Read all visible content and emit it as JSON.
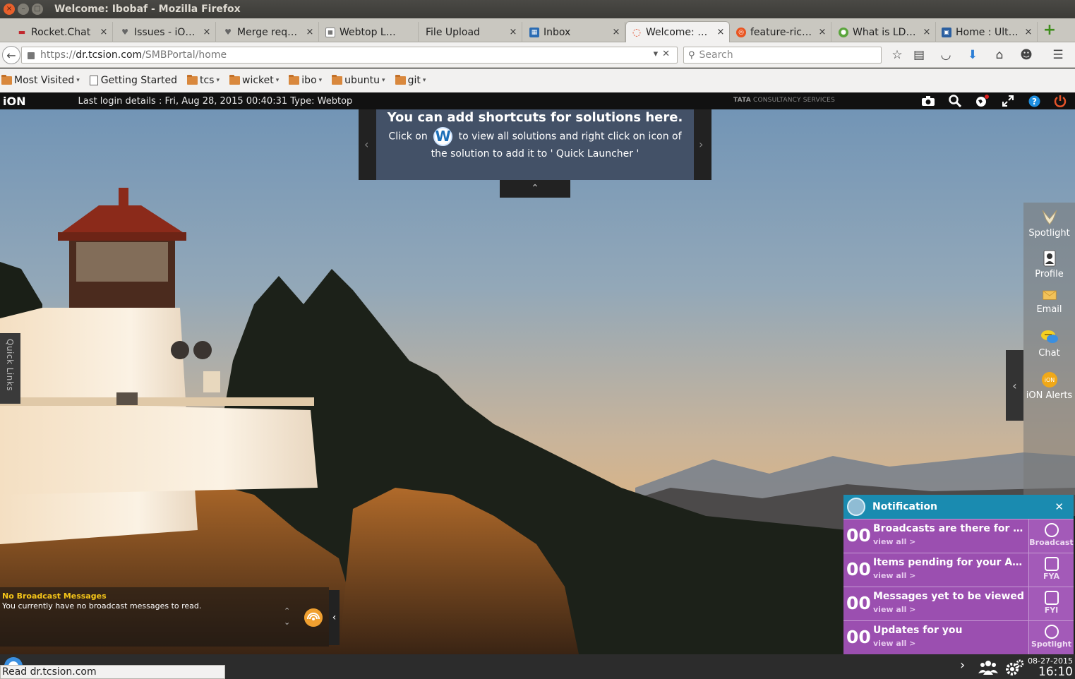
{
  "window": {
    "title": "Welcome: Ibobaf - Mozilla Firefox",
    "close_glyph": "×",
    "min_glyph": "–",
    "max_glyph": "□"
  },
  "tabs": [
    {
      "label": "Rocket.Chat",
      "active": false
    },
    {
      "label": "Issues - iO…",
      "active": false
    },
    {
      "label": "Merge req…",
      "active": false
    },
    {
      "label": "Webtop L…",
      "active": false
    },
    {
      "label": "File Upload",
      "active": false
    },
    {
      "label": "Inbox",
      "active": false
    },
    {
      "label": "Welcome: …",
      "active": true
    },
    {
      "label": "feature-ric…",
      "active": false
    },
    {
      "label": "What is LD…",
      "active": false
    },
    {
      "label": "Home : Ult…",
      "active": false
    }
  ],
  "tab_close_glyph": "×",
  "new_tab_glyph": "+",
  "nav": {
    "back_glyph": "←",
    "url_scheme": "https://",
    "url_host": "dr.tcsion.com",
    "url_path": "/SMBPortal/home",
    "url_tools": "▾✕",
    "search_placeholder": "Search",
    "search_glyph": "⚲",
    "icons": {
      "bookmark": "☆",
      "reading": "▤",
      "pocket": "◡",
      "download": "⬇",
      "home": "⌂",
      "chat": "☻",
      "menu": "☰"
    }
  },
  "bookmarks": [
    {
      "label": "Most Visited",
      "type": "folder",
      "dropdown": true
    },
    {
      "label": "Getting Started",
      "type": "page",
      "dropdown": false
    },
    {
      "label": "tcs",
      "type": "folder",
      "dropdown": true
    },
    {
      "label": "wicket",
      "type": "folder",
      "dropdown": true
    },
    {
      "label": "ibo",
      "type": "folder",
      "dropdown": true
    },
    {
      "label": "ubuntu",
      "type": "folder",
      "dropdown": true
    },
    {
      "label": "git",
      "type": "folder",
      "dropdown": true
    }
  ],
  "bookmark_caret": "▾",
  "ionbar": {
    "brand": "iON",
    "login_details": "Last login details : Fri, Aug 28, 2015 00:40:31 Type: Webtop",
    "vendor_bold": "TATA",
    "vendor_rest": " CONSULTANCY SERVICES"
  },
  "shortcut_panel": {
    "heading": "You can add shortcuts for solutions here.",
    "text_before": "Click on",
    "logo_letter": "W",
    "text_after": "to view all solutions and right click on icon of the solution to add it to ' Quick Launcher '",
    "prev_glyph": "‹",
    "next_glyph": "›",
    "toggle_glyph": "⌃"
  },
  "quick_links_label": "Quick Links",
  "right_sidebar": [
    {
      "label": "Spotlight",
      "icon": "spotlight-icon"
    },
    {
      "label": "Profile",
      "icon": "profile-icon"
    },
    {
      "label": "Email",
      "icon": "email-icon"
    },
    {
      "label": "Chat",
      "icon": "chat-icon"
    },
    {
      "label": "iON Alerts",
      "icon": "ion-alerts-icon"
    }
  ],
  "right_sidebar_collapse_glyph": "‹",
  "ion_alert_badge": "iON",
  "broadcast": {
    "title": "No Broadcast Messages",
    "message": "You currently have no broadcast messages to read.",
    "up_glyph": "⌃",
    "down_glyph": "⌄",
    "toggle_glyph": "‹"
  },
  "notification": {
    "title": "Notification",
    "close_glyph": "✕",
    "rows": [
      {
        "count": "00",
        "title": "Broadcasts are there for …",
        "link": "view all >",
        "side_label": "Broadcast",
        "side_icon": "broadcast-icon"
      },
      {
        "count": "00",
        "title": "Items pending for your A…",
        "link": "view all >",
        "side_label": "FYA",
        "side_icon": "fya-icon"
      },
      {
        "count": "00",
        "title": "Messages yet to be viewed",
        "link": "view all >",
        "side_label": "FYI",
        "side_icon": "fyi-icon"
      },
      {
        "count": "00",
        "title": "Updates for you",
        "link": "view all >",
        "side_label": "Spotlight",
        "side_icon": "spotlight-icon"
      }
    ]
  },
  "status_text": "Read dr.tcsion.com",
  "taskbar": {
    "chevron": "›",
    "date": "08-27-2015",
    "time": "16:10"
  },
  "colors": {
    "notification_header": "#1a8bb0",
    "notification_row": "#9b4fb0",
    "ion_bar": "#111111",
    "active_tab": "#f2f1f0"
  }
}
